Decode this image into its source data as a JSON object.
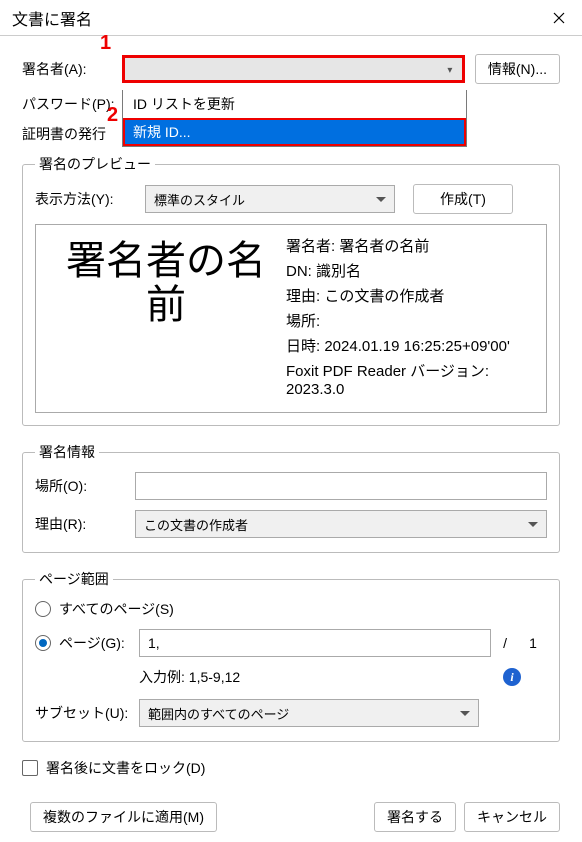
{
  "title": "文書に署名",
  "annot": {
    "n1": "1",
    "n2": "2"
  },
  "signer": {
    "label": "署名者(A):",
    "value": "",
    "info_btn": "情報(N)...",
    "dropdown": {
      "item_update": "ID リストを更新",
      "item_new": "新規 ID..."
    }
  },
  "password_label": "パスワード(P):",
  "cert_issue_label": "証明書の発行",
  "preview": {
    "legend": "署名のプレビュー",
    "display_label": "表示方法(Y):",
    "display_value": "標準のスタイル",
    "create_btn": "作成(T)",
    "big_name": "署名者の名前",
    "details": {
      "signer": "署名者: 署名者の名前",
      "dn": "DN: 識別名",
      "reason": "理由: この文書の作成者",
      "place": "場所:",
      "date": "日時: 2024.01.19 16:25:25+09'00'",
      "app": "Foxit PDF Reader バージョン: 2023.3.0"
    }
  },
  "siginfo": {
    "legend": "署名情報",
    "place_label": "場所(O):",
    "place_value": "",
    "reason_label": "理由(R):",
    "reason_value": "この文書の作成者"
  },
  "pagerange": {
    "legend": "ページ範囲",
    "all_label": "すべてのページ(S)",
    "pages_label": "ページ(G):",
    "pages_value": "1,",
    "total": "1",
    "example": "入力例: 1,5-9,12",
    "subset_label": "サブセット(U):",
    "subset_value": "範囲内のすべてのページ"
  },
  "lock_label": "署名後に文書をロック(D)",
  "apply_multi_btn": "複数のファイルに適用(M)",
  "sign_btn": "署名する",
  "cancel_btn": "キャンセル"
}
